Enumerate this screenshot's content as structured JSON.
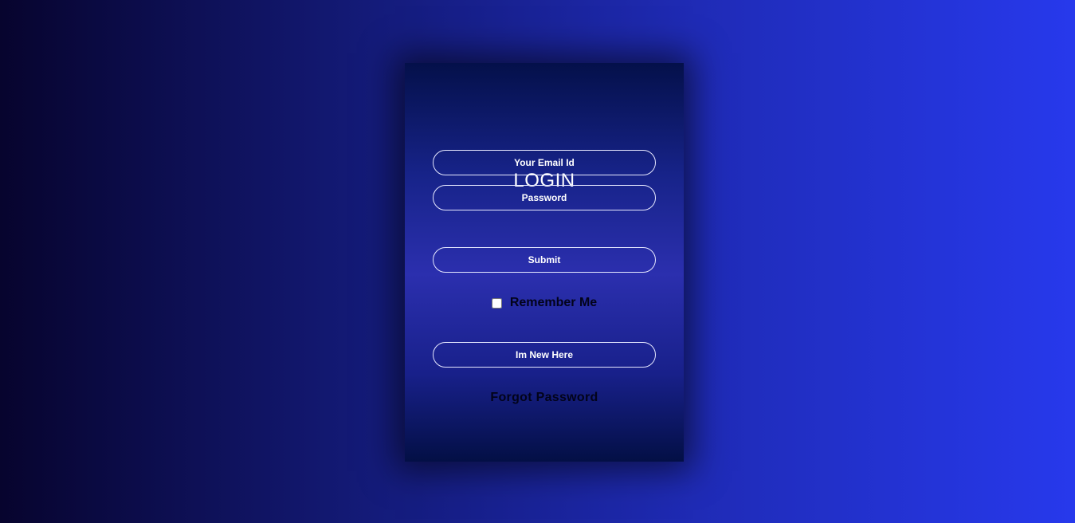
{
  "login": {
    "title": "LOGIN",
    "email_placeholder": "Your Email Id",
    "password_placeholder": "Password",
    "submit_label": "Submit",
    "remember_label": "Remember Me",
    "remember_checked": false,
    "new_user_label": "Im New Here",
    "forgot_label": "Forgot Password"
  },
  "colors": {
    "page_gradient_left": "#07042e",
    "page_gradient_right": "#2739ec",
    "card_edge": "#04104a",
    "card_center": "#2b2fae",
    "pill_border": "#e6e8ff",
    "text_white": "#ffffff",
    "text_dark": "#02031a"
  }
}
